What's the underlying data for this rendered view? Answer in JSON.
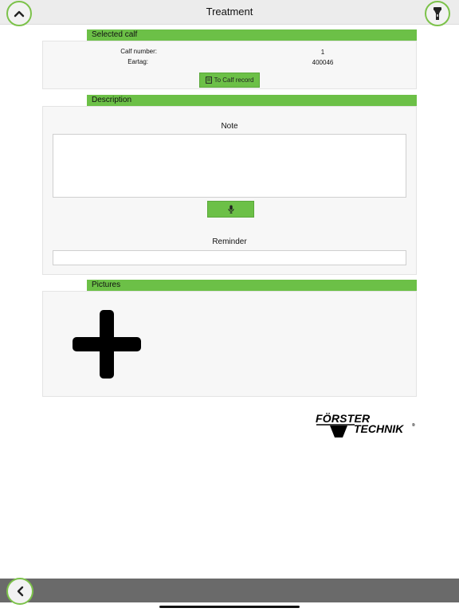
{
  "header": {
    "title": "Treatment"
  },
  "selected_calf": {
    "section_title": "Selected calf",
    "calf_number_label": "Calf number:",
    "calf_number_value": "1",
    "eartag_label": "Eartag:",
    "eartag_value": "400046",
    "button_label": "To Calf record"
  },
  "description": {
    "section_title": "Description",
    "note_label": "Note",
    "note_value": "",
    "reminder_label": "Reminder",
    "reminder_value": ""
  },
  "pictures": {
    "section_title": "Pictures"
  },
  "logo": {
    "line1": "FÖRSTER",
    "line2": "TECHNIK",
    "mark": "®"
  },
  "icons": {
    "top_left": "chevron-up-icon",
    "top_right": "flashlight-icon",
    "bottom_left": "chevron-left-icon",
    "mic": "microphone-icon",
    "calf_button": "record-icon",
    "add": "plus-icon"
  },
  "colors": {
    "accent_green": "#6cc047",
    "ring_green": "#7cc24a",
    "bottom_bar": "#6a6a6a"
  }
}
